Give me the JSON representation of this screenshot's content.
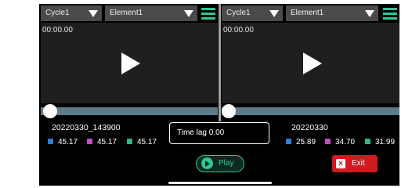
{
  "colors": {
    "accent": "#2fc79a",
    "slider_track": "#5e7b8a",
    "exit": "#d01a1f",
    "series_blue": "#2e7fd6",
    "series_magenta": "#c24ec2",
    "series_green": "#30b88a"
  },
  "left": {
    "cycle": "Cycle1",
    "element": "Element1",
    "timecode": "00:00.00",
    "filename": "20220330_143900",
    "values": [
      "45.17",
      "45.17",
      "45.17"
    ],
    "slider_position": 0
  },
  "right": {
    "cycle": "Cycle1",
    "element": "Element1",
    "timecode": "00:00.00",
    "filename": "20220330",
    "values": [
      "25.89",
      "34.70",
      "31.99"
    ],
    "slider_position": 0
  },
  "timelag": {
    "label": "Time lag",
    "value": "0.00"
  },
  "buttons": {
    "play": "Play",
    "exit": "Exit"
  },
  "icons": {
    "dropdown": "caret-down-icon",
    "menu": "list-menu-icon",
    "play": "play-icon",
    "exit": "close-icon"
  }
}
